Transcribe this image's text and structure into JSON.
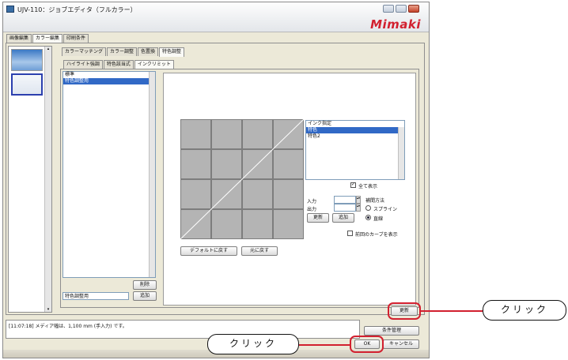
{
  "window": {
    "title": "UJV-110：ジョブエディタ（フルカラー）",
    "logo": "Mimaki",
    "colors": {
      "accent": "#d2202f",
      "selection": "#3169c6"
    }
  },
  "main_tabs": [
    "画像編集",
    "カラー編集",
    "印刷条件"
  ],
  "color_tabs": [
    "カラーマッチング",
    "カラー調整",
    "色置換",
    "特色調整"
  ],
  "sub_tabs": [
    "ハイライト強調",
    "特色該当式",
    "インクリミット"
  ],
  "limit_list": {
    "items": [
      "標準",
      "特色調整用"
    ],
    "selected_index": 1,
    "delete_button": "削除",
    "name_field_value": "特色調整用",
    "add_button": "追加"
  },
  "curve_buttons": {
    "default": "デフォルトに戻す",
    "undo": "元に戻す"
  },
  "ink_panel": {
    "heading": "インク指定",
    "items": [
      "特色",
      "特色2"
    ],
    "selected_index": 0,
    "show_all_label": "全て表示",
    "show_all_checked": true
  },
  "io": {
    "input_label": "入力",
    "output_label": "出力",
    "update_button": "更新",
    "add_button": "追加"
  },
  "interpolation": {
    "heading": "補間方法",
    "options": [
      "スプライン",
      "直線"
    ],
    "selected": "直線"
  },
  "prev_curve_label": "前回のカーブを表示",
  "update_main_button": "更新",
  "status_message": "[11:07:18] メディア幅は、1,100 mm (手入力) です。",
  "condition_button": "条件管理",
  "ok_button": "OK",
  "cancel_button": "キャンセル",
  "callouts": {
    "right": "クリック",
    "bottom": "クリック"
  },
  "icons": [
    "app-icon",
    "minimize-icon",
    "maximize-icon",
    "close-icon",
    "scroll-up-icon",
    "scroll-down-icon",
    "spin-up-icon",
    "spin-down-icon"
  ]
}
